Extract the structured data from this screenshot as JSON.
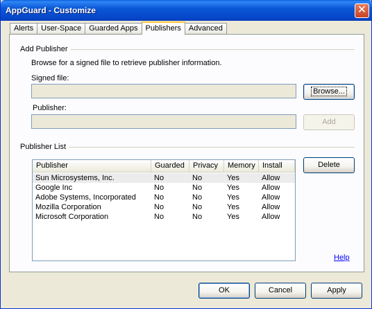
{
  "window": {
    "title": "AppGuard - Customize"
  },
  "close_glyph": "✕",
  "tabs": [
    {
      "label": "Alerts"
    },
    {
      "label": "User-Space"
    },
    {
      "label": "Guarded Apps"
    },
    {
      "label": "Publishers",
      "active": true
    },
    {
      "label": "Advanced"
    }
  ],
  "add_publisher": {
    "group_label": "Add Publisher",
    "description": "Browse for a signed file to retrieve publisher information.",
    "signed_file_label": "Signed file:",
    "signed_file_value": "",
    "publisher_label": "Publisher:",
    "publisher_value": "",
    "browse_label": "Browse...",
    "add_label": "Add"
  },
  "publisher_list": {
    "group_label": "Publisher List",
    "delete_label": "Delete",
    "columns": [
      "Publisher",
      "Guarded",
      "Privacy",
      "Memory",
      "Install"
    ],
    "rows": [
      [
        "Sun Microsystems, Inc.",
        "No",
        "No",
        "Yes",
        "Allow"
      ],
      [
        "Google Inc",
        "No",
        "No",
        "Yes",
        "Allow"
      ],
      [
        "Adobe Systems, Incorporated",
        "No",
        "No",
        "Yes",
        "Allow"
      ],
      [
        "Mozilla Corporation",
        "No",
        "No",
        "Yes",
        "Allow"
      ],
      [
        "Microsoft Corporation",
        "No",
        "No",
        "Yes",
        "Allow"
      ]
    ]
  },
  "help_label": "Help",
  "footer": {
    "ok_label": "OK",
    "cancel_label": "Cancel",
    "apply_label": "Apply"
  }
}
